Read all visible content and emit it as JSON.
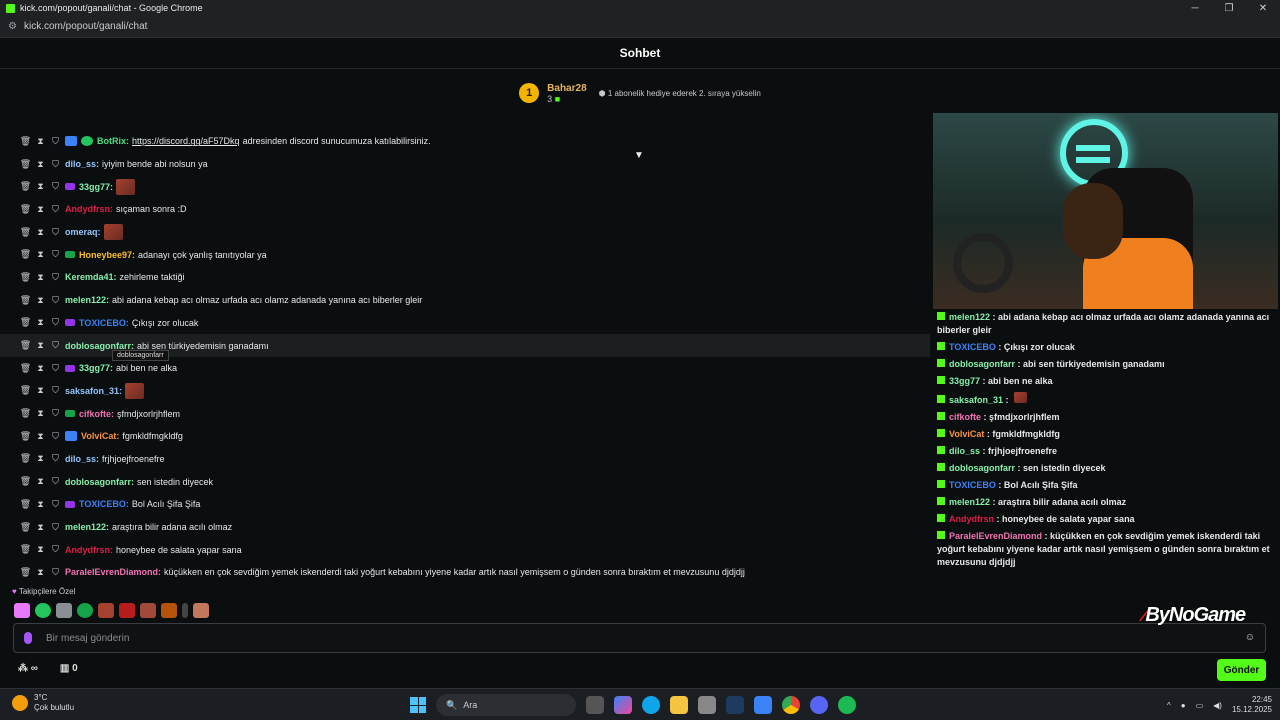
{
  "browser": {
    "title": "kick.com/popout/ganali/chat - Google Chrome",
    "url": "kick.com/popout/ganali/chat"
  },
  "chat": {
    "header": "Sohbet",
    "pinned": {
      "rank": "1",
      "user": "Bahar28",
      "count": "3",
      "message": "1 abonelik hediye ederek 2. sıraya yükselin"
    },
    "tooltip": "doblosagonfarr",
    "messages": [
      {
        "user": "BotRix",
        "color": "#4ade80",
        "text_pre": "",
        "link": "https://discord.gg/aF57Dkq",
        "text": "adresinden discord sunucumuza katılabilirsiniz."
      },
      {
        "user": "dilo_ss",
        "color": "#93c5fd",
        "text": "iyiyim bende abi nolsun ya"
      },
      {
        "user": "33gg77",
        "color": "#86efac",
        "text": ""
      },
      {
        "user": "Andydfrsn",
        "color": "#e11d48",
        "text": "sıçaman sonra :D"
      },
      {
        "user": "omeraq",
        "color": "#93c5fd",
        "text": ""
      },
      {
        "user": "Honeybee97",
        "color": "#fbbf24",
        "text": "adanayı çok yanlış tanıtıyolar ya"
      },
      {
        "user": "Keremda41",
        "color": "#86efac",
        "text": "zehirleme taktiği"
      },
      {
        "user": "melen122",
        "color": "#86efac",
        "text": "abi adana kebap acı olmaz urfada acı olamz adanada yanına acı biberler gleir"
      },
      {
        "user": "TOXICEBO",
        "color": "#3b82f6",
        "text": "Çıkışı zor olucak"
      },
      {
        "user": "doblosagonfarr",
        "color": "#86efac",
        "text": "abi sen türkiyedemisin ganadamı"
      },
      {
        "user": "33gg77",
        "color": "#86efac",
        "text": "abi ben ne alka"
      },
      {
        "user": "saksafon_31",
        "color": "#93c5fd",
        "text": ""
      },
      {
        "user": "cifkofte",
        "color": "#f472b6",
        "text": "şfmdjxorlrjhflem"
      },
      {
        "user": "VolviCat",
        "color": "#fb923c",
        "text": "fgmkldfmgkldfg"
      },
      {
        "user": "dilo_ss",
        "color": "#93c5fd",
        "text": "frjhjoejfroenefre"
      },
      {
        "user": "doblosagonfarr",
        "color": "#86efac",
        "text": "sen istedin diyecek"
      },
      {
        "user": "TOXICEBO",
        "color": "#3b82f6",
        "text": "Bol Acılı Şifa Şifa"
      },
      {
        "user": "melen122",
        "color": "#86efac",
        "text": "araştıra bilir adana acılı olmaz"
      },
      {
        "user": "Andydfrsn",
        "color": "#e11d48",
        "text": "honeybee de salata yapar sana"
      },
      {
        "user": "ParalelEvrenDiamond",
        "color": "#f472b6",
        "text": "küçükken en çok sevdiğim yemek iskenderdi taki yoğurt kebabını yiyene kadar artık nasıl yemişsem o günden sonra bıraktım et mevzusunu djdjdjj"
      }
    ],
    "followers_only": "Takipçilere Özel",
    "input_placeholder": "Bir mesaj gönderin",
    "points": "∞",
    "store_count": "0",
    "send_label": "Gönder"
  },
  "overlay": {
    "brand": "ByNoGame",
    "messages": [
      {
        "user": "melen122",
        "color": "#86efac",
        "text": "abi adana kebap acı olmaz urfada acı olamz adanada yanına acı biberler gleir"
      },
      {
        "user": "TOXICEBO",
        "color": "#3b82f6",
        "text": "Çıkışı zor olucak"
      },
      {
        "user": "doblosagonfarr",
        "color": "#86efac",
        "text": "abi sen türkiyedemisin ganadamı"
      },
      {
        "user": "33gg77",
        "color": "#86efac",
        "text": "abi ben ne alka"
      },
      {
        "user": "saksafon_31",
        "color": "#86efac",
        "text": ""
      },
      {
        "user": "cifkofte",
        "color": "#f472b6",
        "text": "şfmdjxorlrjhflem"
      },
      {
        "user": "VolviCat",
        "color": "#fb923c",
        "text": "fgmkldfmgkldfg"
      },
      {
        "user": "dilo_ss",
        "color": "#86efac",
        "text": "frjhjoejfroenefre"
      },
      {
        "user": "doblosagonfarr",
        "color": "#86efac",
        "text": "sen istedin diyecek"
      },
      {
        "user": "TOXICEBO",
        "color": "#3b82f6",
        "text": "Bol Acılı Şifa Şifa"
      },
      {
        "user": "melen122",
        "color": "#86efac",
        "text": "araştıra bilir adana acılı olmaz"
      },
      {
        "user": "Andydfrsn",
        "color": "#e11d48",
        "text": "honeybee de salata yapar sana"
      },
      {
        "user": "ParalelEvrenDiamond",
        "color": "#f472b6",
        "text": "küçükken en çok sevdiğim yemek iskenderdi taki yoğurt kebabını yiyene kadar artık nasıl yemişsem o günden sonra bıraktım et mevzusunu djdjdjj"
      }
    ]
  },
  "taskbar": {
    "temp": "3°C",
    "weather": "Çok bulutlu",
    "search": "Ara",
    "time": "22:45",
    "date": "15.12.2025"
  }
}
